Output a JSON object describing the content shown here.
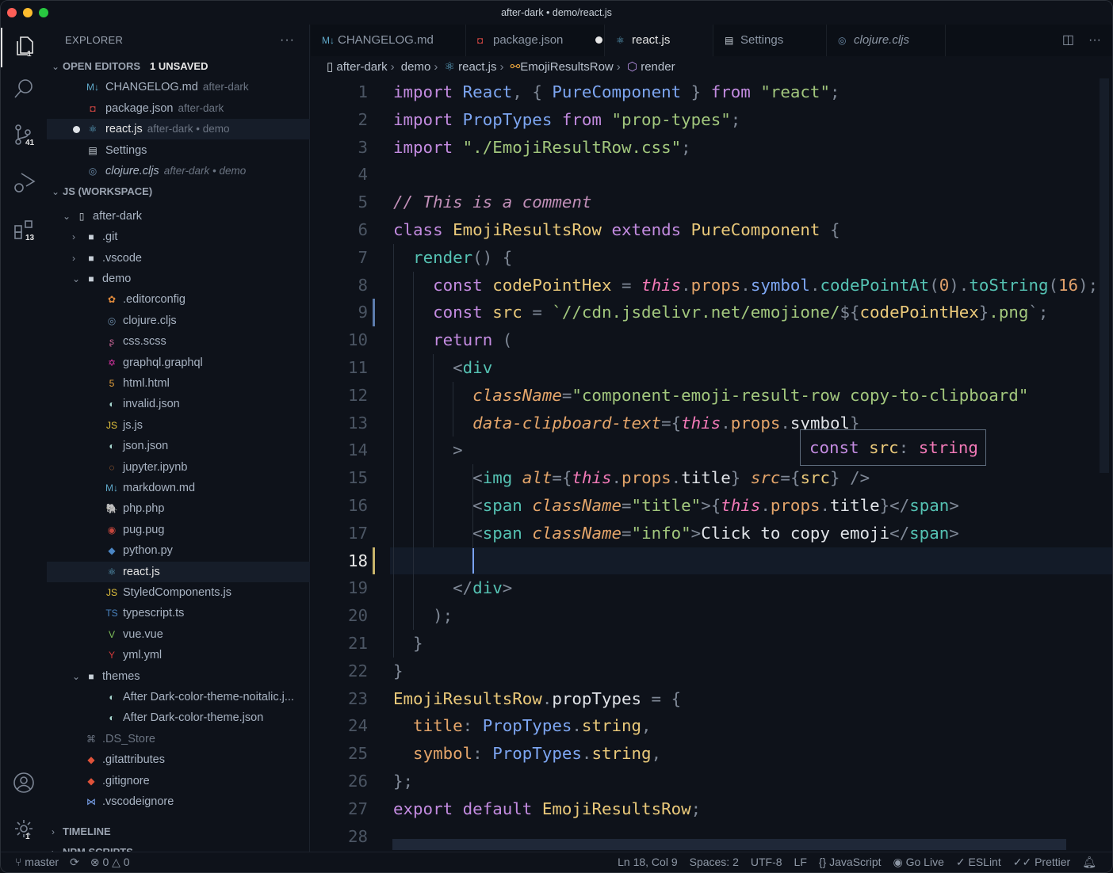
{
  "window": {
    "title": "after-dark • demo/react.js"
  },
  "activity": [
    {
      "icon": "files-icon",
      "badge": "1"
    },
    {
      "icon": "search-icon",
      "badge": ""
    },
    {
      "icon": "source-control-icon",
      "badge": "41"
    },
    {
      "icon": "run-debug-icon",
      "badge": ""
    },
    {
      "icon": "extensions-icon",
      "badge": "13"
    },
    {
      "icon": "account-icon",
      "badge": ""
    },
    {
      "icon": "settings-gear-icon",
      "badge": "1"
    }
  ],
  "sidebar": {
    "title": "EXPLORER",
    "more": "···",
    "open_editors": {
      "label": "OPEN EDITORS",
      "unsaved": "1 UNSAVED",
      "items": [
        {
          "name": "CHANGELOG.md",
          "desc": "after-dark",
          "icon": "markdown-icon",
          "glyph": "M↓",
          "color": "#5fa8c9"
        },
        {
          "name": "package.json",
          "desc": "after-dark",
          "icon": "npm-icon",
          "glyph": "◘",
          "color": "#c2423f"
        },
        {
          "name": "react.js",
          "desc": "after-dark • demo",
          "icon": "react-icon",
          "glyph": "⚛",
          "color": "#5fa8c9",
          "modified": true
        },
        {
          "name": "Settings",
          "desc": "",
          "icon": "document-icon",
          "glyph": "▤",
          "color": "#c9d1d9"
        },
        {
          "name": "clojure.cljs",
          "desc": "after-dark • demo",
          "icon": "clojure-icon",
          "glyph": "◎",
          "color": "#6c8ba8",
          "italic": true
        }
      ]
    },
    "workspace": {
      "label": "JS (WORKSPACE)",
      "tree": [
        {
          "name": "after-dark",
          "depth": 0,
          "chev": "⌄",
          "icon": "repo-icon",
          "glyph": "▯",
          "color": "#c9d1d9"
        },
        {
          "name": ".git",
          "depth": 1,
          "chev": "›",
          "icon": "folder-icon",
          "glyph": "■",
          "color": "#c9d1d9"
        },
        {
          "name": ".vscode",
          "depth": 1,
          "chev": "›",
          "icon": "folder-icon",
          "glyph": "■",
          "color": "#c9d1d9"
        },
        {
          "name": "demo",
          "depth": 1,
          "chev": "⌄",
          "icon": "folder-open-icon",
          "glyph": "■",
          "color": "#c9d1d9"
        },
        {
          "name": ".editorconfig",
          "depth": 2,
          "icon": "editorconfig-icon",
          "glyph": "✿",
          "color": "#e08a3c"
        },
        {
          "name": "clojure.cljs",
          "depth": 2,
          "icon": "clojure-icon",
          "glyph": "◎",
          "color": "#6c8ba8"
        },
        {
          "name": "css.scss",
          "depth": 2,
          "icon": "sass-icon",
          "glyph": "ʂ",
          "color": "#cd6799"
        },
        {
          "name": "graphql.graphql",
          "depth": 2,
          "icon": "graphql-icon",
          "glyph": "✡",
          "color": "#e535ab"
        },
        {
          "name": "html.html",
          "depth": 2,
          "icon": "html-icon",
          "glyph": "5",
          "color": "#e8a33c"
        },
        {
          "name": "invalid.json",
          "depth": 2,
          "icon": "json-icon",
          "glyph": "◐",
          "color": "#a8d8d0"
        },
        {
          "name": "js.js",
          "depth": 2,
          "icon": "javascript-icon",
          "glyph": "JS",
          "color": "#e8c63c"
        },
        {
          "name": "json.json",
          "depth": 2,
          "icon": "json-icon",
          "glyph": "◐",
          "color": "#a8d8d0"
        },
        {
          "name": "jupyter.ipynb",
          "depth": 2,
          "icon": "jupyter-icon",
          "glyph": "◌",
          "color": "#e8863c"
        },
        {
          "name": "markdown.md",
          "depth": 2,
          "icon": "markdown-icon",
          "glyph": "M↓",
          "color": "#5fa8c9"
        },
        {
          "name": "php.php",
          "depth": 2,
          "icon": "php-icon",
          "glyph": "🐘",
          "color": "#7a86b8"
        },
        {
          "name": "pug.pug",
          "depth": 2,
          "icon": "pug-icon",
          "glyph": "◉",
          "color": "#c4463c"
        },
        {
          "name": "python.py",
          "depth": 2,
          "icon": "python-icon",
          "glyph": "◆",
          "color": "#4b86c4"
        },
        {
          "name": "react.js",
          "depth": 2,
          "icon": "react-icon",
          "glyph": "⚛",
          "color": "#5fa8c9",
          "selected": true
        },
        {
          "name": "StyledComponents.js",
          "depth": 2,
          "icon": "javascript-icon",
          "glyph": "JS",
          "color": "#e8c63c"
        },
        {
          "name": "typescript.ts",
          "depth": 2,
          "icon": "typescript-icon",
          "glyph": "TS",
          "color": "#4b86c4"
        },
        {
          "name": "vue.vue",
          "depth": 2,
          "icon": "vue-icon",
          "glyph": "V",
          "color": "#7fc15a"
        },
        {
          "name": "yml.yml",
          "depth": 2,
          "icon": "yaml-icon",
          "glyph": "Y",
          "color": "#d43a3a"
        },
        {
          "name": "themes",
          "depth": 1,
          "chev": "⌄",
          "icon": "folder-open-icon",
          "glyph": "■",
          "color": "#c9d1d9"
        },
        {
          "name": "After Dark-color-theme-noitalic.j...",
          "depth": 2,
          "icon": "json-icon",
          "glyph": "◐",
          "color": "#a8d8d0"
        },
        {
          "name": "After Dark-color-theme.json",
          "depth": 2,
          "icon": "json-icon",
          "glyph": "◐",
          "color": "#a8d8d0"
        },
        {
          "name": ".DS_Store",
          "depth": 1,
          "icon": "ds-store-icon",
          "glyph": "⌘",
          "color": "#6b7482",
          "dim": true
        },
        {
          "name": ".gitattributes",
          "depth": 1,
          "icon": "git-icon",
          "glyph": "◆",
          "color": "#e0533a"
        },
        {
          "name": ".gitignore",
          "depth": 1,
          "icon": "git-icon",
          "glyph": "◆",
          "color": "#e0533a"
        },
        {
          "name": ".vscodeignore",
          "depth": 1,
          "icon": "vscode-icon",
          "glyph": "⋈",
          "color": "#7da6f2"
        }
      ]
    },
    "timeline": "TIMELINE",
    "npm": "NPM SCRIPTS"
  },
  "tabs": [
    {
      "label": "CHANGELOG.md",
      "icon": "markdown-icon",
      "glyph": "M↓",
      "color": "#5fa8c9"
    },
    {
      "label": "package.json",
      "icon": "npm-icon",
      "glyph": "◘",
      "color": "#c2423f"
    },
    {
      "label": "react.js",
      "icon": "react-icon",
      "glyph": "⚛",
      "color": "#5fa8c9",
      "active": true,
      "modified": true
    },
    {
      "label": "Settings",
      "icon": "document-icon",
      "glyph": "▤",
      "color": "#c9d1d9"
    },
    {
      "label": "clojure.cljs",
      "icon": "clojure-icon",
      "glyph": "◎",
      "color": "#6c8ba8",
      "italic": true
    }
  ],
  "breadcrumb": [
    "after-dark",
    "demo",
    "react.js",
    "EmojiResultsRow",
    "render"
  ],
  "editor": {
    "current_line": 18,
    "code": [
      [
        [
          "import",
          "kw"
        ],
        [
          " "
        ],
        [
          "React",
          "pt"
        ],
        [
          ", ",
          "pu"
        ],
        [
          "{ ",
          "pu"
        ],
        [
          "PureComponent",
          "pt"
        ],
        [
          " } ",
          "pu"
        ],
        [
          "from",
          "kw"
        ],
        [
          " "
        ],
        [
          "\"react\"",
          "str"
        ],
        [
          ";",
          "pu"
        ]
      ],
      [
        [
          "import",
          "kw"
        ],
        [
          " "
        ],
        [
          "PropTypes",
          "pt"
        ],
        [
          " "
        ],
        [
          "from",
          "kw"
        ],
        [
          " "
        ],
        [
          "\"prop-types\"",
          "str"
        ],
        [
          ";",
          "pu"
        ]
      ],
      [
        [
          "import",
          "kw"
        ],
        [
          " "
        ],
        [
          "\"./EmojiResultRow.css\"",
          "str"
        ],
        [
          ";",
          "pu"
        ]
      ],
      [],
      [
        [
          "// This is a comment",
          "cm"
        ]
      ],
      [
        [
          "class",
          "kw"
        ],
        [
          " "
        ],
        [
          "EmojiResultsRow",
          "cls"
        ],
        [
          " "
        ],
        [
          "extends",
          "kw"
        ],
        [
          " "
        ],
        [
          "PureComponent",
          "cls"
        ],
        [
          " {",
          "pu"
        ]
      ],
      [
        [
          "  "
        ],
        [
          "render",
          "fn"
        ],
        [
          "() {",
          "pu"
        ]
      ],
      [
        [
          "    "
        ],
        [
          "const",
          "kw"
        ],
        [
          " "
        ],
        [
          "codePointHex",
          "vr"
        ],
        [
          " = ",
          "pu"
        ],
        [
          "this",
          "th"
        ],
        [
          ".",
          "pu"
        ],
        [
          "props",
          "pr"
        ],
        [
          ".",
          "pu"
        ],
        [
          "symbol",
          "pt"
        ],
        [
          ".",
          "pu"
        ],
        [
          "codePointAt",
          "fn"
        ],
        [
          "(",
          "pu"
        ],
        [
          "0",
          "num"
        ],
        [
          ")",
          "pu"
        ],
        [
          ".",
          "pu"
        ],
        [
          "toString",
          "fn"
        ],
        [
          "(",
          "pu"
        ],
        [
          "16",
          "num"
        ],
        [
          ");",
          "pu"
        ]
      ],
      [
        [
          "    "
        ],
        [
          "const",
          "kw"
        ],
        [
          " "
        ],
        [
          "src",
          "vr"
        ],
        [
          " = ",
          "pu"
        ],
        [
          "`//cdn.jsdelivr.net/emojione/",
          "str"
        ],
        [
          "${",
          "pu"
        ],
        [
          "codePointHex",
          "vr"
        ],
        [
          "}",
          "pu"
        ],
        [
          ".png",
          "str"
        ],
        [
          "`;",
          "pu"
        ]
      ],
      [
        [
          "    "
        ],
        [
          "return",
          "kw"
        ],
        [
          " (",
          "pu"
        ]
      ],
      [
        [
          "      "
        ],
        [
          "<",
          "pu"
        ],
        [
          "div",
          "tg"
        ]
      ],
      [
        [
          "        "
        ],
        [
          "className",
          "at"
        ],
        [
          "=",
          "pu"
        ],
        [
          "\"component-emoji-result-row copy-to-clipboard\"",
          "str"
        ]
      ],
      [
        [
          "        "
        ],
        [
          "data-clipboard-text",
          "at"
        ],
        [
          "=",
          "pu"
        ],
        [
          "{",
          "pu"
        ],
        [
          "this",
          "th"
        ],
        [
          ".",
          "pu"
        ],
        [
          "props",
          "pr"
        ],
        [
          ".",
          "pu"
        ],
        [
          "symbol",
          "tx"
        ],
        [
          "}",
          "pu"
        ]
      ],
      [
        [
          "      "
        ],
        [
          ">",
          "pu"
        ]
      ],
      [
        [
          "        "
        ],
        [
          "<",
          "pu"
        ],
        [
          "img",
          "tg"
        ],
        [
          " "
        ],
        [
          "alt",
          "at"
        ],
        [
          "=",
          "pu"
        ],
        [
          "{",
          "pu"
        ],
        [
          "this",
          "th"
        ],
        [
          ".",
          "pu"
        ],
        [
          "props",
          "pr"
        ],
        [
          ".",
          "pu"
        ],
        [
          "title",
          "tx"
        ],
        [
          "}",
          "pu"
        ],
        [
          " "
        ],
        [
          "src",
          "at"
        ],
        [
          "=",
          "pu"
        ],
        [
          "{",
          "pu"
        ],
        [
          "src",
          "vr"
        ],
        [
          "}",
          "pu"
        ],
        [
          " />",
          "pu"
        ]
      ],
      [
        [
          "        "
        ],
        [
          "<",
          "pu"
        ],
        [
          "span",
          "tg"
        ],
        [
          " "
        ],
        [
          "className",
          "at"
        ],
        [
          "=",
          "pu"
        ],
        [
          "\"title\"",
          "str"
        ],
        [
          ">",
          "pu"
        ],
        [
          "{",
          "pu"
        ],
        [
          "this",
          "th"
        ],
        [
          ".",
          "pu"
        ],
        [
          "props",
          "pr"
        ],
        [
          ".",
          "pu"
        ],
        [
          "title",
          "tx"
        ],
        [
          "}",
          "pu"
        ],
        [
          "</",
          "pu"
        ],
        [
          "span",
          "tg"
        ],
        [
          ">",
          "pu"
        ]
      ],
      [
        [
          "        "
        ],
        [
          "<",
          "pu"
        ],
        [
          "span",
          "tg"
        ],
        [
          " "
        ],
        [
          "className",
          "at"
        ],
        [
          "=",
          "pu"
        ],
        [
          "\"info\"",
          "str"
        ],
        [
          ">",
          "pu"
        ],
        [
          "Click to copy emoji",
          "tx"
        ],
        [
          "</",
          "pu"
        ],
        [
          "span",
          "tg"
        ],
        [
          ">",
          "pu"
        ]
      ],
      [],
      [
        [
          "      "
        ],
        [
          "</",
          "pu"
        ],
        [
          "div",
          "tg"
        ],
        [
          ">",
          "pu"
        ]
      ],
      [
        [
          "    "
        ],
        [
          ");",
          "pu"
        ]
      ],
      [
        [
          "  "
        ],
        [
          "}",
          "pu"
        ]
      ],
      [
        [
          "}",
          "pu"
        ]
      ],
      [
        [
          "EmojiResultsRow",
          "cls"
        ],
        [
          ".",
          "pu"
        ],
        [
          "propTypes",
          "tx"
        ],
        [
          " = {",
          "pu"
        ]
      ],
      [
        [
          "  "
        ],
        [
          "title",
          "pr"
        ],
        [
          ": ",
          "pu"
        ],
        [
          "PropTypes",
          "pt"
        ],
        [
          ".",
          "pu"
        ],
        [
          "string",
          "vr"
        ],
        [
          ",",
          "pu"
        ]
      ],
      [
        [
          "  "
        ],
        [
          "symbol",
          "pr"
        ],
        [
          ": ",
          "pu"
        ],
        [
          "PropTypes",
          "pt"
        ],
        [
          ".",
          "pu"
        ],
        [
          "string",
          "vr"
        ],
        [
          ",",
          "pu"
        ]
      ],
      [
        [
          "};",
          "pu"
        ]
      ],
      [
        [
          "export",
          "kw"
        ],
        [
          " "
        ],
        [
          "default",
          "kw"
        ],
        [
          " "
        ],
        [
          "EmojiResultsRow",
          "cls"
        ],
        [
          ";",
          "pu"
        ]
      ],
      []
    ],
    "hover": {
      "kw": "const",
      "name": "src",
      "sep": ": ",
      "type": "string"
    }
  },
  "status": {
    "branch": "master",
    "errors": "0",
    "warnings": "0",
    "position": "Ln 18, Col 9",
    "spaces": "Spaces: 2",
    "encoding": "UTF-8",
    "eol": "LF",
    "language": "JavaScript",
    "golive": "Go Live",
    "eslint": "ESLint",
    "prettier": "Prettier"
  }
}
